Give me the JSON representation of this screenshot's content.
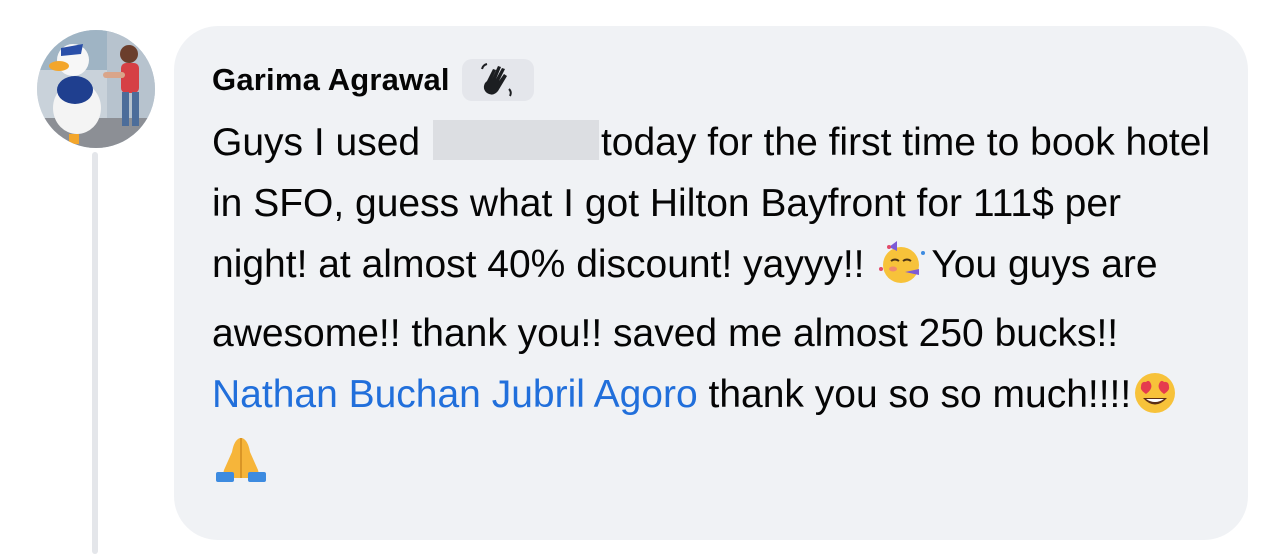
{
  "comment": {
    "author": "Garima Agrawal",
    "author_badge_icon": "waving-hand-icon",
    "text_before_redaction": "Guys I used",
    "text_after_redaction": "today for the first time to book hotel in SFO, guess what I got Hilton Bayfront for 111$ per night! at almost 40% discount! yayyy!!",
    "text_after_party_emoji": "You guys are awesome!! thank you!! saved me almost 250 bucks!!",
    "mentions": [
      "Nathan Buchan",
      "Jubril Agoro"
    ],
    "text_after_mentions": "thank you so so much!!!!",
    "emojis": [
      "partying-face-icon",
      "heart-eyes-icon",
      "folded-hands-icon"
    ]
  },
  "colors": {
    "bubble_bg": "#f0f2f5",
    "mention": "#216fdb",
    "text": "#050505"
  }
}
